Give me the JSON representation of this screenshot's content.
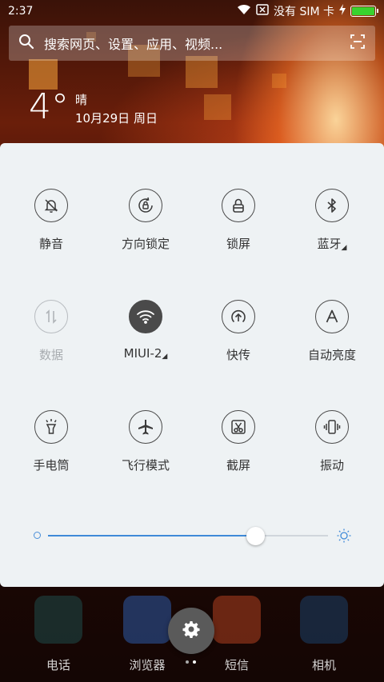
{
  "status_bar": {
    "time": "2:37",
    "carrier": "没有 SIM 卡",
    "battery_level": 1.0,
    "battery_color": "#39d22e"
  },
  "search": {
    "placeholder": "搜索网页、设置、应用、视频..."
  },
  "weather": {
    "temperature": "4°",
    "condition": "晴",
    "date": "10月29日 周日"
  },
  "quick_settings": {
    "tiles": [
      {
        "label": "静音",
        "icon": "bell-off-icon",
        "state": "off"
      },
      {
        "label": "方向锁定",
        "icon": "rotation-lock-icon",
        "state": "off"
      },
      {
        "label": "锁屏",
        "icon": "lock-icon",
        "state": "off"
      },
      {
        "label": "蓝牙",
        "icon": "bluetooth-icon",
        "state": "off",
        "has_menu": true
      },
      {
        "label": "数据",
        "icon": "mobile-data-icon",
        "state": "disabled"
      },
      {
        "label": "MIUI-2",
        "icon": "wifi-icon",
        "state": "on",
        "has_menu": true
      },
      {
        "label": "快传",
        "icon": "share-upload-icon",
        "state": "off"
      },
      {
        "label": "自动亮度",
        "icon": "auto-brightness-icon",
        "state": "off"
      },
      {
        "label": "手电筒",
        "icon": "flashlight-icon",
        "state": "off"
      },
      {
        "label": "飞行模式",
        "icon": "airplane-icon",
        "state": "off"
      },
      {
        "label": "截屏",
        "icon": "screenshot-icon",
        "state": "off"
      },
      {
        "label": "振动",
        "icon": "vibrate-icon",
        "state": "off"
      }
    ],
    "brightness_level": 0.74,
    "accent_color": "#3f8ad8"
  },
  "dock": {
    "apps": [
      {
        "label": "电话",
        "icon": "phone-app-icon"
      },
      {
        "label": "浏览器",
        "icon": "browser-app-icon"
      },
      {
        "label": "短信",
        "icon": "messages-app-icon"
      },
      {
        "label": "相机",
        "icon": "camera-app-icon"
      }
    ],
    "page_count": 2,
    "active_page": 1
  }
}
